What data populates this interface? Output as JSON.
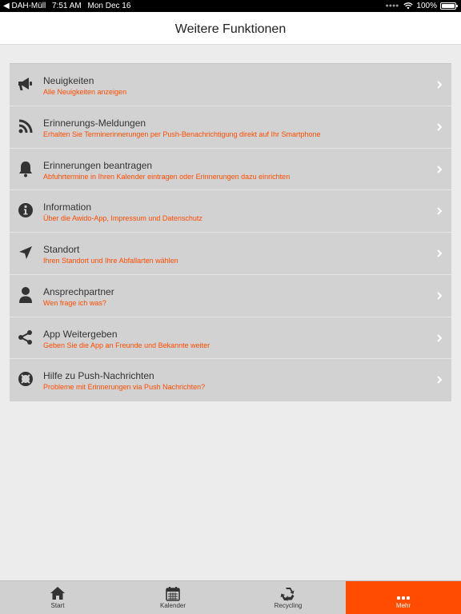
{
  "status_bar": {
    "carrier": "◀ DAH-Müll",
    "time": "7:51 AM",
    "date": "Mon Dec 16",
    "battery": "100%"
  },
  "nav": {
    "title": "Weitere Funktionen"
  },
  "menu": {
    "items": [
      {
        "title": "Neuigkeiten",
        "subtitle": "Alle Neuigkeiten anzeigen",
        "icon": "megaphone-icon"
      },
      {
        "title": "Erinnerungs-Meldungen",
        "subtitle": "Erhalten Sie Terminerinnerungen per Push-Benachrichtigung direkt auf Ihr Smartphone",
        "icon": "rss-icon"
      },
      {
        "title": "Erinnerungen beantragen",
        "subtitle": "Abfuhrtermine in Ihren Kalender eintragen oder Erinnerungen dazu einrichten",
        "icon": "bell-icon"
      },
      {
        "title": "Information",
        "subtitle": "Über die Awido-App, Impressum und Datenschutz",
        "icon": "info-icon"
      },
      {
        "title": "Standort",
        "subtitle": "Ihren Standort und Ihre Abfallarten wählen",
        "icon": "location-arrow-icon"
      },
      {
        "title": "Ansprechpartner",
        "subtitle": "Wen frage ich was?",
        "icon": "user-icon"
      },
      {
        "title": "App Weitergeben",
        "subtitle": "Geben Sie die App an Freunde und Bekannte weiter",
        "icon": "share-icon"
      },
      {
        "title": "Hilfe zu Push-Nachrichten",
        "subtitle": "Probleme mit Erinnerungen via Push Nachrichten?",
        "icon": "lifebuoy-icon"
      }
    ]
  },
  "tabs": {
    "items": [
      {
        "label": "Start",
        "icon": "home-icon"
      },
      {
        "label": "Kalender",
        "icon": "calendar-icon"
      },
      {
        "label": "Recycling",
        "icon": "recycle-icon"
      },
      {
        "label": "Mehr",
        "icon": "more-icon",
        "active": true
      }
    ]
  },
  "colors": {
    "accent": "#ff4c00",
    "list_background": "#d2d2d2",
    "page_background": "#ececec"
  }
}
